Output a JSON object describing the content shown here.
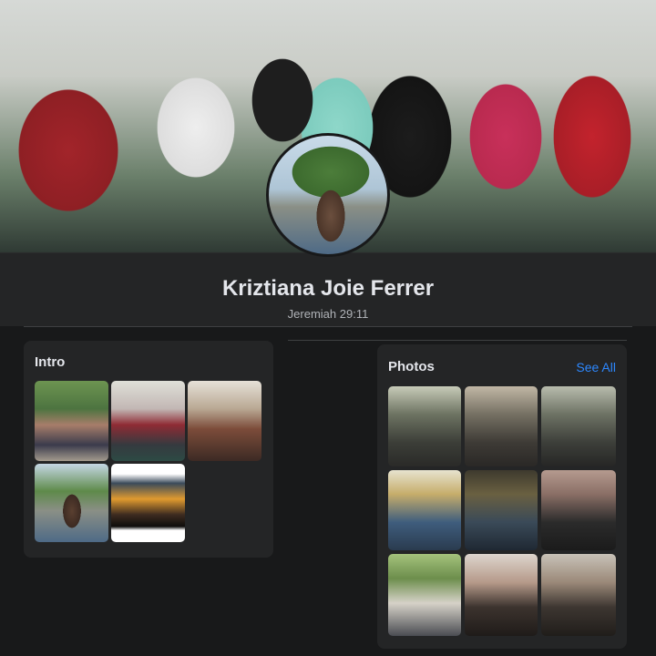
{
  "profile": {
    "name": "Kriztiana Joie Ferrer",
    "bio": "Jeremiah 29:11"
  },
  "intro": {
    "title": "Intro",
    "thumbnails": [
      "photo",
      "photo",
      "photo",
      "photo",
      "photo"
    ]
  },
  "photos": {
    "title": "Photos",
    "see_all_label": "See All",
    "count_visible": 9
  },
  "colors": {
    "background": "#18191a",
    "card": "#242526",
    "text_primary": "#e4e6eb",
    "text_secondary": "#b0b3b8",
    "link": "#2d88ff"
  }
}
